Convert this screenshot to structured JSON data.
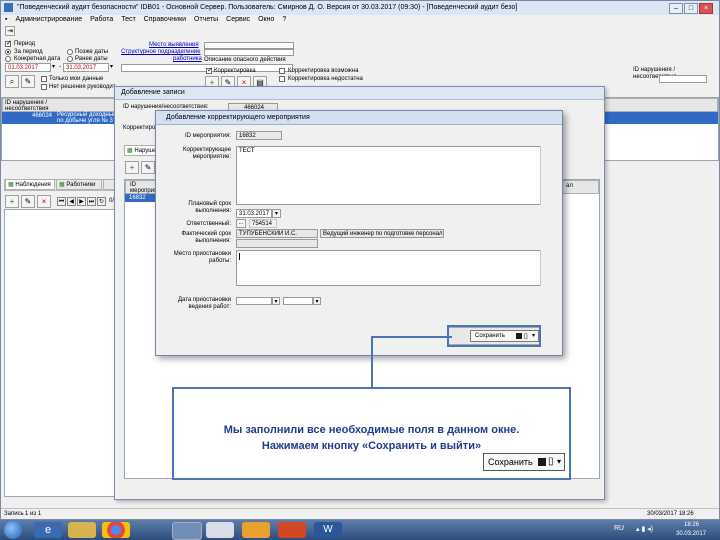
{
  "window": {
    "title": "\"Поведенческий аудит безопасности\"   IDB01 - Основной Сервер.   Пользователь: Смирнов Д. О.   Версия от 30.03.2017 (09:30)  -  [Поведенческий аудит безо]"
  },
  "menu": [
    "Администрирование",
    "Работа",
    "Тест",
    "Справочники",
    "Отчеты",
    "Сервис",
    "Окно",
    "?"
  ],
  "filter": {
    "period_label": "Период",
    "period_radio": "За период",
    "specific_date_radio": "Конкретная дата",
    "later_dates_radio": "Позже даты",
    "earlier_dates_radio": "Ранее даты",
    "date_from": "01.03.2017",
    "date_to": "31.03.2017",
    "only_my_data": "Только мои данные",
    "no_manager_decision": "Нет решения руководит",
    "detection_place_link": "Место выявления",
    "structural_unit_link": "Структурное подразделение",
    "worker_link": "работника",
    "dangerous_action_desc": "Описание опасного действия",
    "correction_button": "Корректировка",
    "correction_possible": "Корректировка возможна",
    "correction_insufficient": "Корректировка недостатна",
    "violation_id_label_right": "ID нарушения / несоответствия"
  },
  "left_grid": {
    "header": "ID нарушения / несоответствия",
    "row_id": "466024",
    "row_text": "Ресурсный доходный по добыче угля № 3"
  },
  "bottom_tabs": {
    "observations": "Наблюдения",
    "workers": "Работники",
    "record_label": "Запись",
    "record_value": "1  из  1",
    "pager_count": "0/0"
  },
  "add_record_dialog": {
    "title": "Добавление записи",
    "violation_id_label": "ID нарушения/несоответствия:",
    "violation_id_value": "466024",
    "correction_label": "Корректировка:",
    "tab_violations": "Нарушения",
    "grid_header_id": "ID мероприятия",
    "grid_row_id": "16832",
    "grid_header_right": "ал"
  },
  "dialog": {
    "title": "Добавление корректирующего мероприятия",
    "measure_id_label": "ID мероприятия:",
    "measure_id_value": "16832",
    "corrective_measure_label": "Корректирующее мероприятие:",
    "corrective_measure_value": "ТЕСТ",
    "planned_date_label": "Плановый срок выполнения:",
    "planned_date_value": "31.03.2017",
    "responsible_label": "Ответственный:",
    "responsible_id": "754514",
    "responsible_name": "ТУПУБЕНСКИЙ И.С.",
    "responsible_position": "Ведущий инженер по подготовке персонал",
    "actual_date_label": "Фактический срок выполнения:",
    "suspension_place_label": "Место приостановки работы:",
    "suspension_date_label": "Дата приостановки ведения работ:",
    "save_button": "Сохранить"
  },
  "status": {
    "datetime": "30/03/2017 18:26"
  },
  "taskbar": {
    "lang": "RU",
    "time": "18:26",
    "date": "30.03.2017"
  },
  "callout": {
    "line1": "Мы заполнили все необходимые поля в данном окне.",
    "line2": "Нажимаем кнопку «Сохранить и выйти»",
    "button_label": "Сохранить"
  },
  "colors": {
    "selection": "#316ac5",
    "callout_border": "#4a74b8",
    "callout_text": "#1f3d8a",
    "taskbar": "#2c4d7c"
  }
}
